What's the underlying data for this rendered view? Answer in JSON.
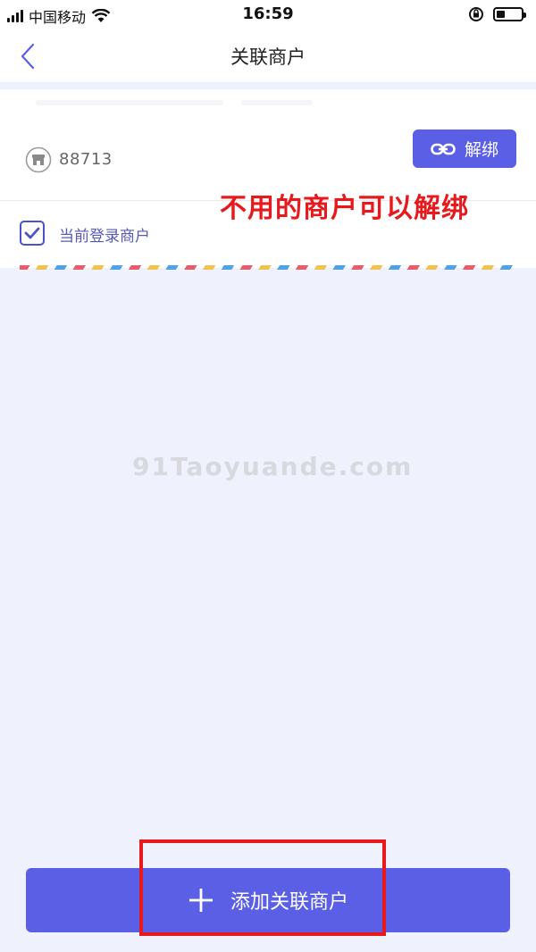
{
  "status_bar": {
    "carrier": "中国移动",
    "time": "16:59",
    "icons": [
      "signal-icon",
      "wifi-icon",
      "rotation-lock-icon",
      "battery-icon"
    ]
  },
  "nav": {
    "title": "关联商户",
    "back_icon": "chevron-left-icon"
  },
  "merchant": {
    "id": "88713",
    "unbind_label": "解绑",
    "store_icon": "store-icon",
    "link_icon": "link-icon",
    "current_login_label": "当前登录商户",
    "current_login_checked": true
  },
  "annotation": {
    "text": "不用的商户可以解绑",
    "color": "#e8191c"
  },
  "watermark": {
    "text": "91Taoyuande.com"
  },
  "footer": {
    "add_label": "添加关联商户",
    "plus_icon": "plus-icon"
  },
  "colors": {
    "accent": "#5b5fe6",
    "background": "#eff1fc",
    "highlight": "#e8191c"
  }
}
